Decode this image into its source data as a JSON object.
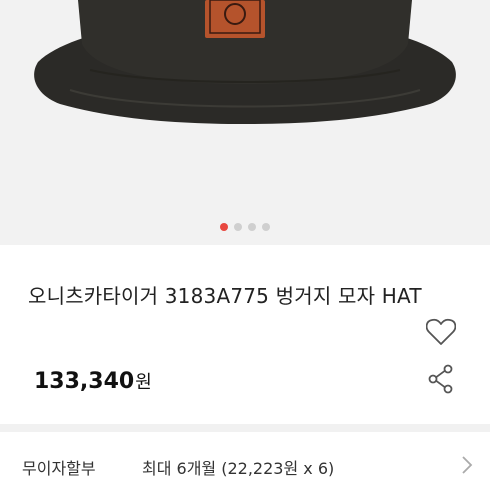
{
  "product_image": {
    "carousel": {
      "total": 4,
      "active_index": 0
    },
    "colors": {
      "background": "#f2f2f2",
      "hat": "#2b2a27",
      "patch": "#b5532c",
      "active_dot": "#e8473f",
      "inactive_dot": "#cfcfcf"
    }
  },
  "product": {
    "title": "오니츠카타이거 3183A775 벙거지 모자 HAT",
    "price": "133,340",
    "currency_unit": "원"
  },
  "actions": {
    "wishlist_icon": "heart-outline-icon",
    "share_icon": "share-icon"
  },
  "installment": {
    "label": "무이자할부",
    "value": "최대 6개월 (22,223원 x 6)"
  }
}
